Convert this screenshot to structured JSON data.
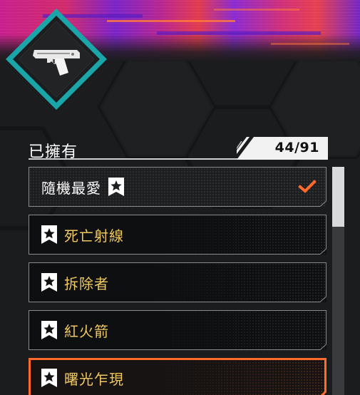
{
  "header": {
    "owned_label": "已擁有",
    "count": "44/91"
  },
  "emblem": {
    "icon": "pistol-icon"
  },
  "list": {
    "items": [
      {
        "label": "隨機最愛",
        "icon_position": "trailing",
        "checked": true,
        "state": "default"
      },
      {
        "label": "死亡射線",
        "icon_position": "leading",
        "checked": false,
        "state": "default"
      },
      {
        "label": "拆除者",
        "icon_position": "leading",
        "checked": false,
        "state": "default"
      },
      {
        "label": "紅火箭",
        "icon_position": "leading",
        "checked": false,
        "state": "default"
      },
      {
        "label": "曙光乍現",
        "icon_position": "leading",
        "checked": false,
        "state": "selected"
      }
    ]
  },
  "colors": {
    "accent_orange": "#ff6a2a",
    "label_gold": "#f0c860",
    "emblem_teal": "#1aa6a8",
    "scroll_thumb": "#d9dadc"
  }
}
